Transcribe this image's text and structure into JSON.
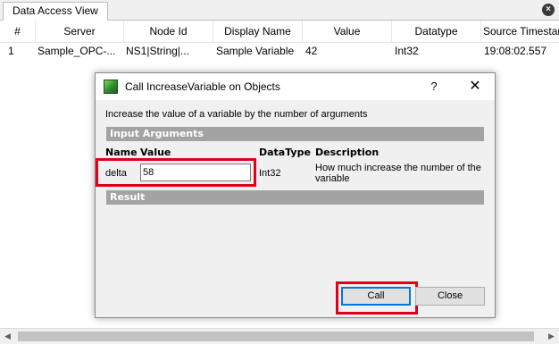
{
  "tab": {
    "label": "Data Access View",
    "close": "×"
  },
  "grid": {
    "columns": [
      "#",
      "Server",
      "Node Id",
      "Display Name",
      "Value",
      "Datatype",
      "Source Timestamp"
    ],
    "rows": [
      [
        "1",
        "Sample_OPC-...",
        "NS1|String|...",
        "Sample Variable",
        "42",
        "Int32",
        "19:08:02.557"
      ]
    ]
  },
  "scrollbar": {
    "left_arrow": "◀",
    "right_arrow": "▶"
  },
  "dialog": {
    "title": "Call IncreaseVariable on Objects",
    "help": "?",
    "close": "✕",
    "intro": "Increase the value of a variable by the number of arguments",
    "input_section": "Input Arguments",
    "headers": {
      "name": "Name",
      "value": "Value",
      "datatype": "DataType",
      "description": "Description"
    },
    "argument": {
      "name": "delta",
      "value": "58",
      "datatype": "Int32",
      "description": "How much increase the number of the variable"
    },
    "result_section": "Result",
    "buttons": {
      "call": "Call",
      "close": "Close"
    }
  },
  "colors": {
    "highlight": "#e0001a",
    "focus_border": "#0078d7",
    "section_bar": "#a3a3a3"
  }
}
